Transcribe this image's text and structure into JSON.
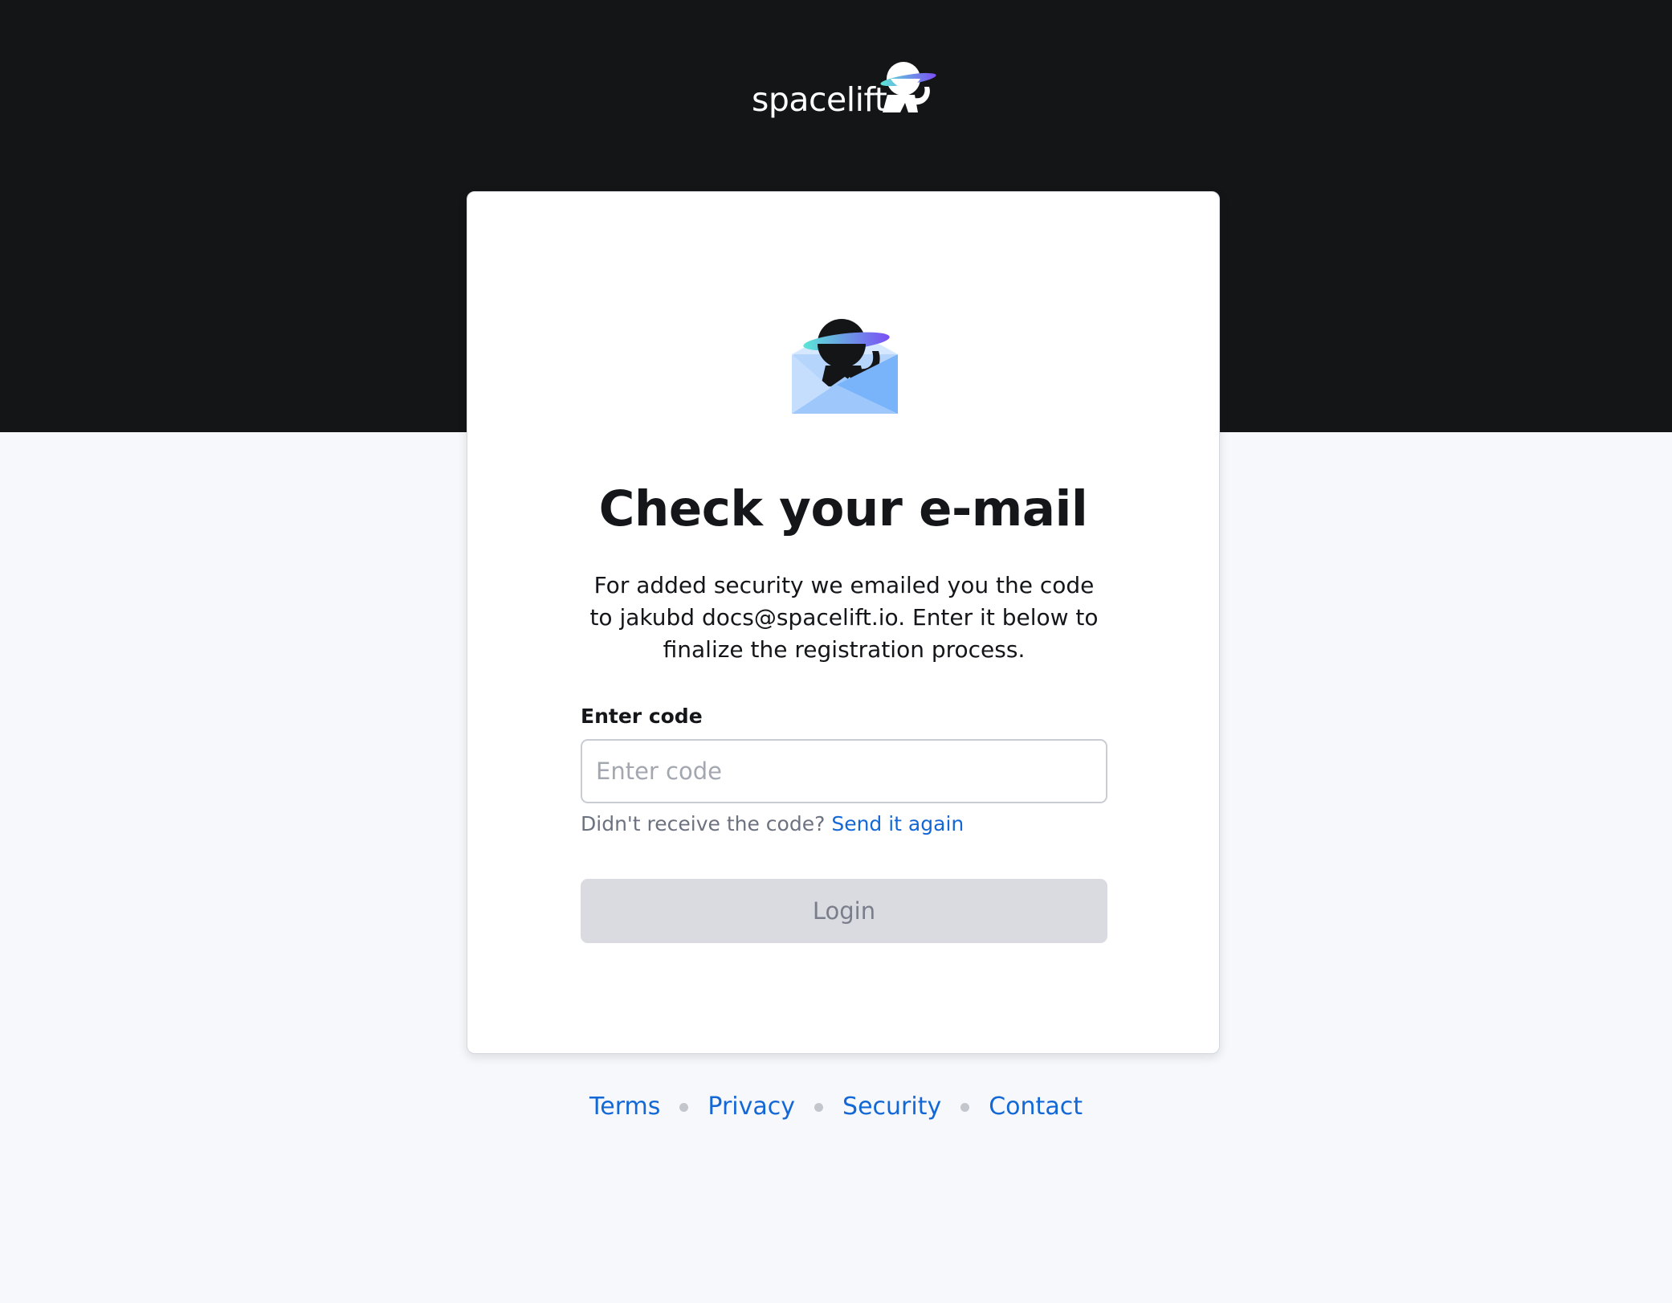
{
  "brand": {
    "wordmark": "spacelift",
    "logo_icon": "astronaut-planet-icon"
  },
  "card": {
    "illustration_icon": "astronaut-envelope-icon",
    "title": "Check your e-mail",
    "description": "For added security we emailed you the code to jakubd docs@spacelift.io. Enter it below to finalize the registration process.",
    "code_field": {
      "label": "Enter code",
      "placeholder": "Enter code",
      "value": ""
    },
    "resend": {
      "prompt": "Didn't receive the code?",
      "link_label": "Send it again"
    },
    "login_label": "Login"
  },
  "footer": {
    "links": [
      "Terms",
      "Privacy",
      "Security",
      "Contact"
    ]
  },
  "colors": {
    "header_background": "#141517",
    "page_background": "#f6f8fb",
    "link": "#1468d6",
    "button_disabled_bg": "#d9dbe1",
    "button_disabled_text": "#7a7e8a",
    "accent_teal": "#5ce6d6",
    "accent_purple": "#7b4ff5",
    "envelope_blue": "#79b4fb"
  }
}
